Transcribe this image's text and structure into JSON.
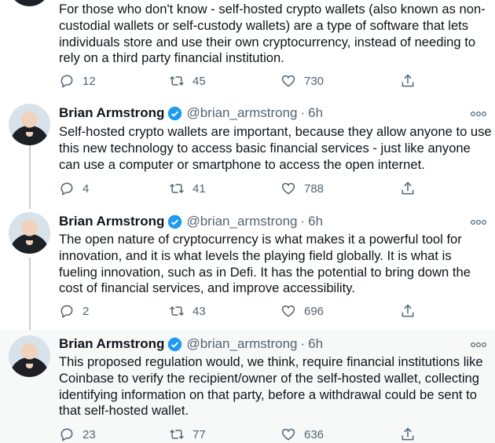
{
  "tweets": [
    {
      "text": "For those who don't know - self-hosted crypto wallets (also known as non-custodial wallets or self-custody wallets) are a type of software that lets individuals store and use their own cryptocurrency, instead of needing to rely on a third party financial institution.",
      "replies": "12",
      "retweets": "45",
      "likes": "730"
    },
    {
      "name": "Brian Armstrong",
      "handle": "@brian_armstrong",
      "separator": "·",
      "time": "6h",
      "text": "Self-hosted crypto wallets are important, because they allow anyone to use this new technology to access basic financial services - just like anyone can use a computer or smartphone to access the open internet.",
      "replies": "4",
      "retweets": "41",
      "likes": "788"
    },
    {
      "name": "Brian Armstrong",
      "handle": "@brian_armstrong",
      "separator": "·",
      "time": "6h",
      "text": "The open nature of cryptocurrency is what makes it a powerful tool for innovation, and it is what levels the playing field globally. It is what is fueling innovation, such as in Defi. It has the potential to bring down the cost of financial services, and improve accessibility.",
      "replies": "2",
      "retweets": "43",
      "likes": "696"
    },
    {
      "name": "Brian Armstrong",
      "handle": "@brian_armstrong",
      "separator": "·",
      "time": "6h",
      "text": "This proposed regulation would, we think, require financial institutions like Coinbase to verify the recipient/owner of the self-hosted wallet, collecting identifying information on that party, before a withdrawal could be sent to that self-hosted wallet.",
      "replies": "23",
      "retweets": "77",
      "likes": "636"
    }
  ],
  "icons": {
    "reply": "reply-icon",
    "retweet": "retweet-icon",
    "like": "heart-icon",
    "share": "share-icon",
    "more": "more-icon",
    "verified": "verified-badge-icon"
  },
  "colors": {
    "accent": "#1d9bf0",
    "muted": "#536471",
    "highlight_bg": "#f7f9f9",
    "thread_line": "#c4cfd6"
  }
}
